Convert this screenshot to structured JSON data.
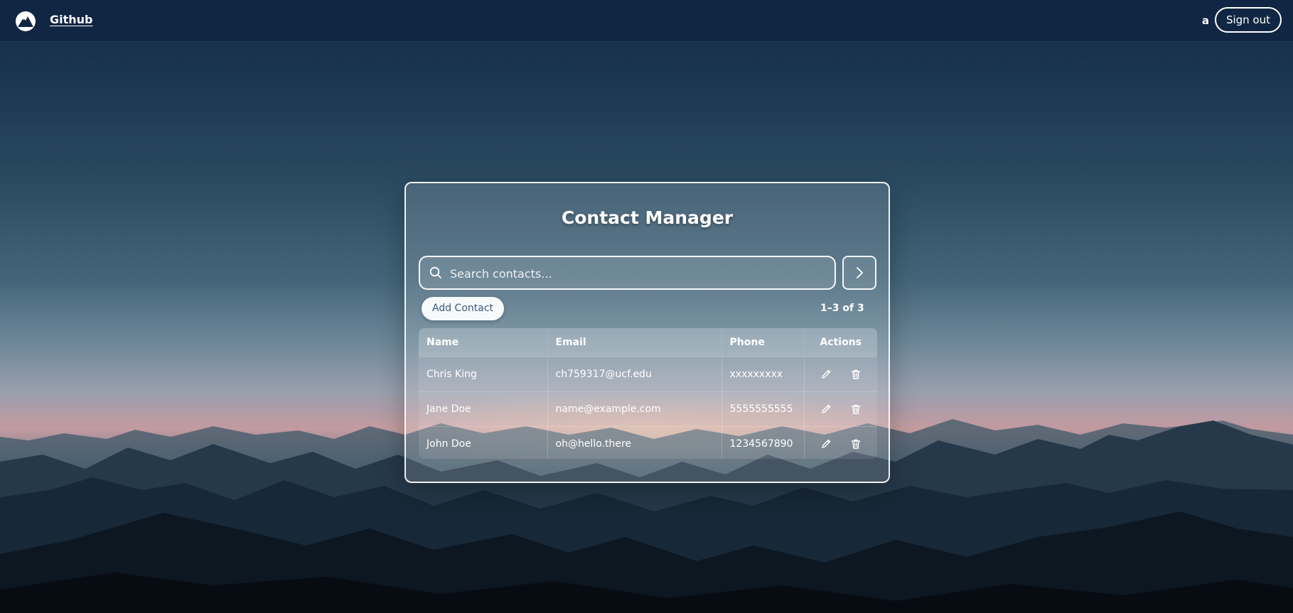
{
  "theme": {
    "topbar_bg": "#112642",
    "accent_text": "#3a5a76"
  },
  "header": {
    "logo_icon": "mountain-logo-icon",
    "brand_label": "Github",
    "username": "a",
    "signout_label": "Sign out"
  },
  "main": {
    "title": "Contact Manager",
    "search": {
      "placeholder": "Search contacts...",
      "value": "",
      "submit_icon": "chevron-right-icon"
    },
    "add_contact_label": "Add Contact",
    "range_label": "1–3 of 3",
    "table": {
      "columns": {
        "name": "Name",
        "email": "Email",
        "phone": "Phone",
        "actions": "Actions"
      },
      "rows": [
        {
          "name": "Chris King",
          "email": "ch759317@ucf.edu",
          "phone": "xxxxxxxxx"
        },
        {
          "name": "Jane Doe",
          "email": "name@example.com",
          "phone": "5555555555"
        },
        {
          "name": "John Doe",
          "email": "oh@hello.there",
          "phone": "1234567890"
        }
      ],
      "action_icons": [
        "pencil-icon",
        "trash-icon"
      ]
    }
  }
}
